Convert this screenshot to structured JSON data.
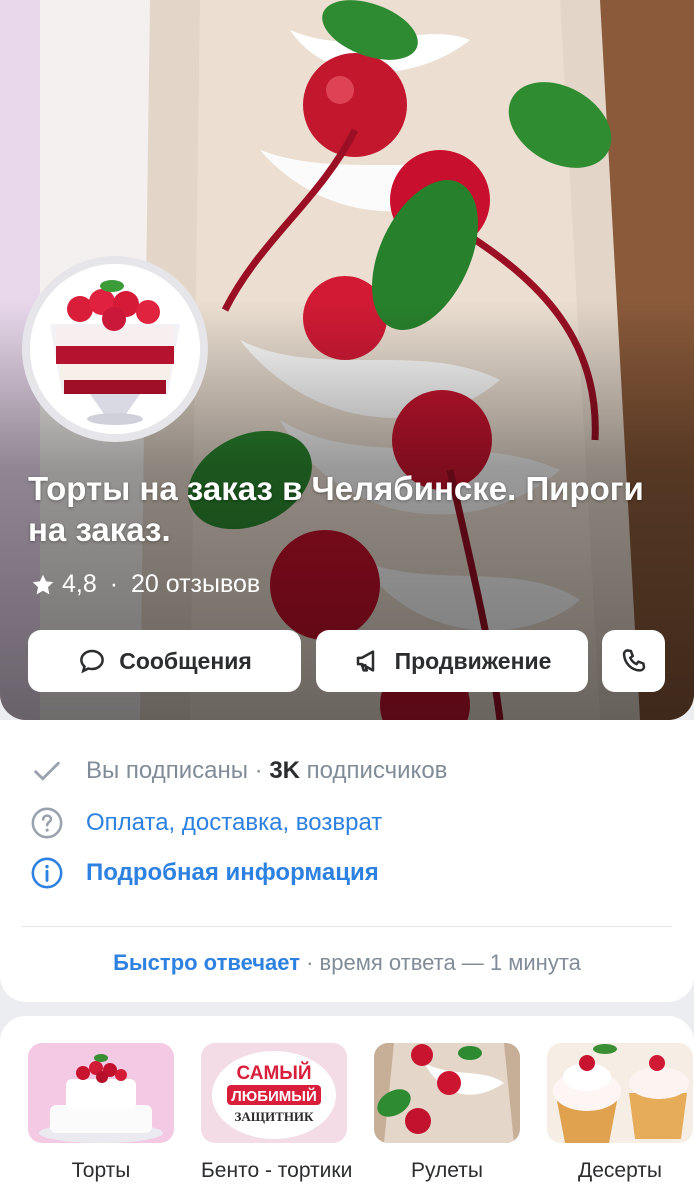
{
  "profile": {
    "title": "Торты на заказ в Челябинске. Пироги на заказ.",
    "rating": "4,8",
    "rating_sep": " · ",
    "reviews": "20 отзывов"
  },
  "actions": {
    "messages_label": "Сообщения",
    "promo_label": "Продвижение",
    "call_icon": "phone-icon"
  },
  "info": {
    "subscribed_text": "Вы подписаны · ",
    "followers_count": "3K",
    "followers_label": " подписчиков",
    "payment_link": "Оплата, доставка, возврат",
    "details_link": "Подробная информация",
    "fast_reply_label": "Быстро отвечает",
    "reply_time": " · время ответа — 1 минута"
  },
  "categories": [
    {
      "label": "Торты"
    },
    {
      "label": "Бенто - тортики",
      "image_text": [
        "САМЫЙ",
        "ЛЮБИМЫЙ",
        "ЗАЩИТНИК"
      ]
    },
    {
      "label": "Рулеты"
    },
    {
      "label": "Десерты"
    }
  ],
  "colors": {
    "accent": "#2d81e0",
    "text_primary": "#2c2d2e",
    "text_secondary": "#818c99",
    "background": "#ebedf0"
  }
}
